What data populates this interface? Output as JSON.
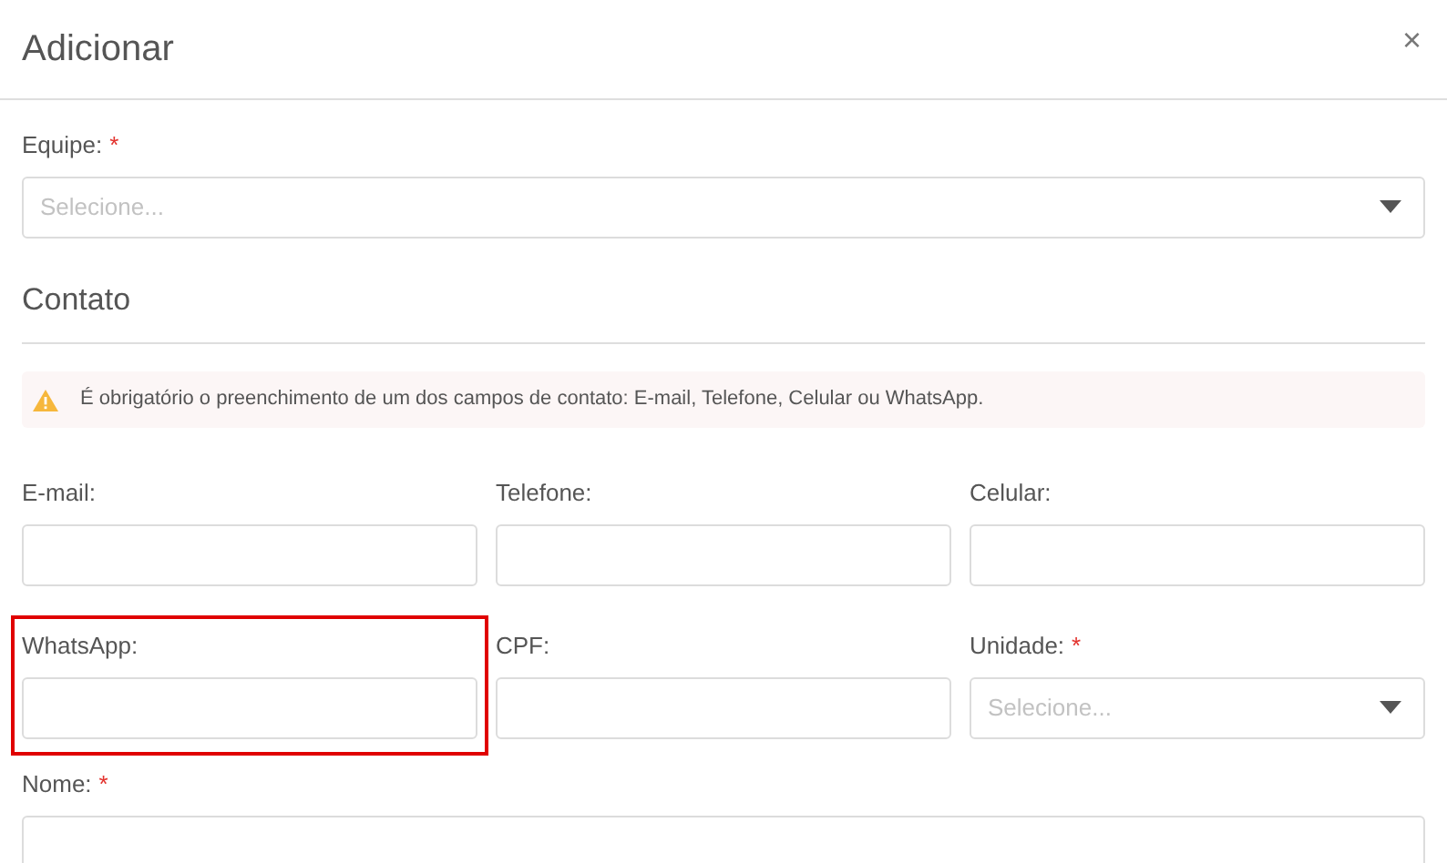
{
  "dialog": {
    "title": "Adicionar",
    "close": "×"
  },
  "team": {
    "label": "Equipe:",
    "required_mark": "*",
    "placeholder": "Selecione..."
  },
  "section": {
    "title": "Contato"
  },
  "alert": {
    "text": "É obrigatório o preenchimento de um dos campos de contato: E-mail, Telefone, Celular ou WhatsApp."
  },
  "fields": [
    {
      "kind": "text",
      "label": "E-mail:",
      "highlighted": false
    },
    {
      "kind": "text",
      "label": "Telefone:",
      "highlighted": false
    },
    {
      "kind": "text",
      "label": "Celular:",
      "highlighted": false
    },
    {
      "kind": "text",
      "label": "WhatsApp:",
      "highlighted": true
    },
    {
      "kind": "text",
      "label": "CPF:",
      "highlighted": false
    },
    {
      "kind": "select",
      "label": "Unidade:",
      "required_mark": "*",
      "highlighted": false,
      "placeholder": "Selecione..."
    }
  ],
  "name_field": {
    "label": "Nome:",
    "required_mark": "*"
  }
}
